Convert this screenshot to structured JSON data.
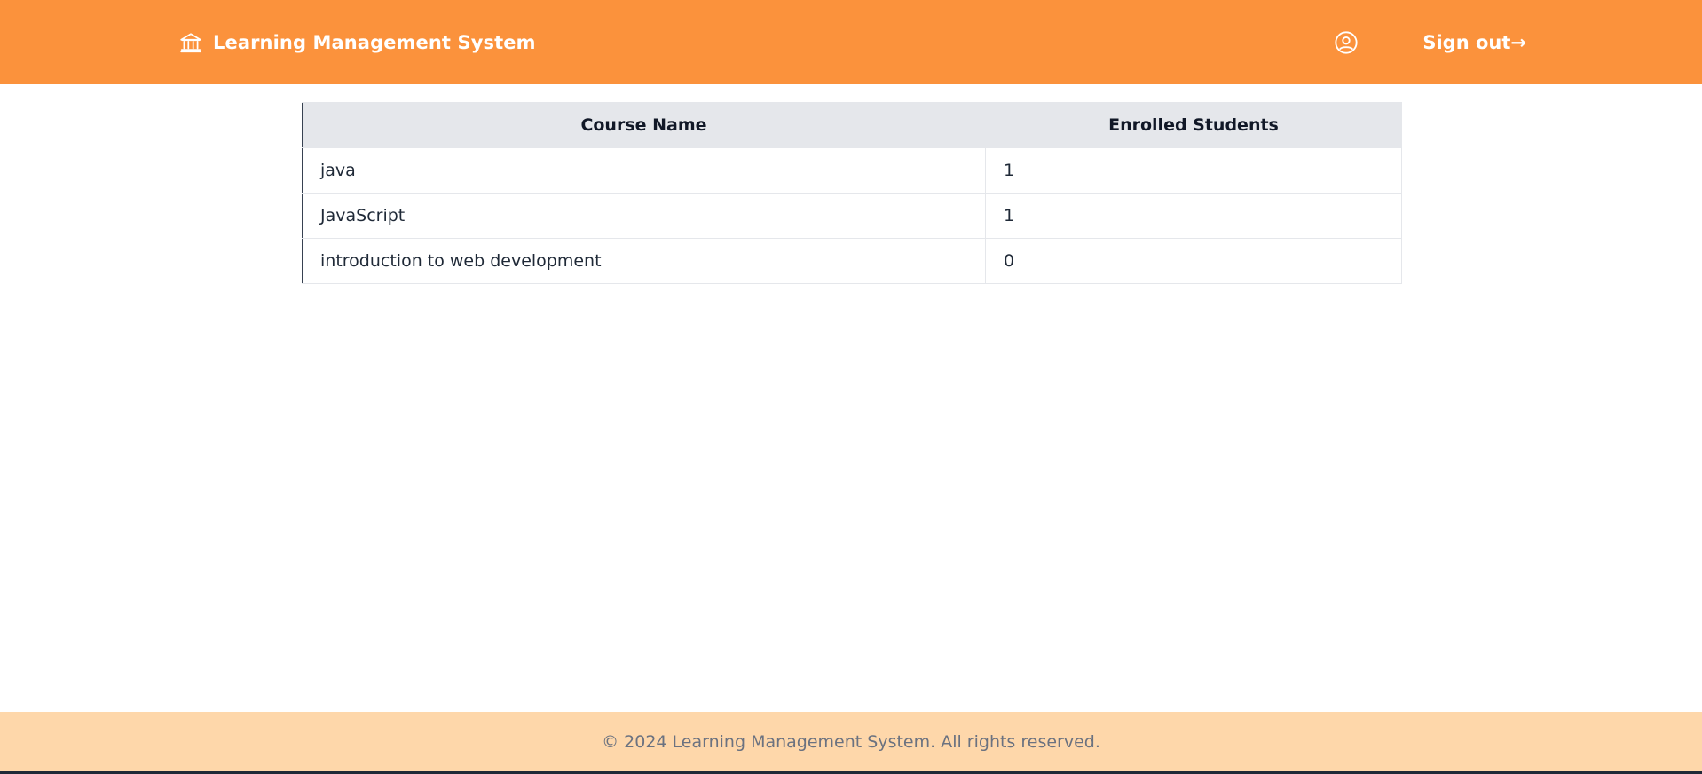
{
  "header": {
    "brand_icon": "bank-icon",
    "title": "Learning Management System",
    "profile_icon": "user-circle-icon",
    "signout_label": "Sign out→"
  },
  "table": {
    "columns": [
      "Course Name",
      "Enrolled Students"
    ],
    "rows": [
      {
        "course": "java",
        "enrolled": "1"
      },
      {
        "course": "JavaScript",
        "enrolled": "1"
      },
      {
        "course": "introduction to web development",
        "enrolled": "0"
      }
    ]
  },
  "footer": {
    "text": "© 2024 Learning Management System. All rights reserved."
  },
  "colors": {
    "header_bg": "#fb923c",
    "footer_bg": "#fed7aa",
    "table_header_bg": "#e5e7eb"
  }
}
